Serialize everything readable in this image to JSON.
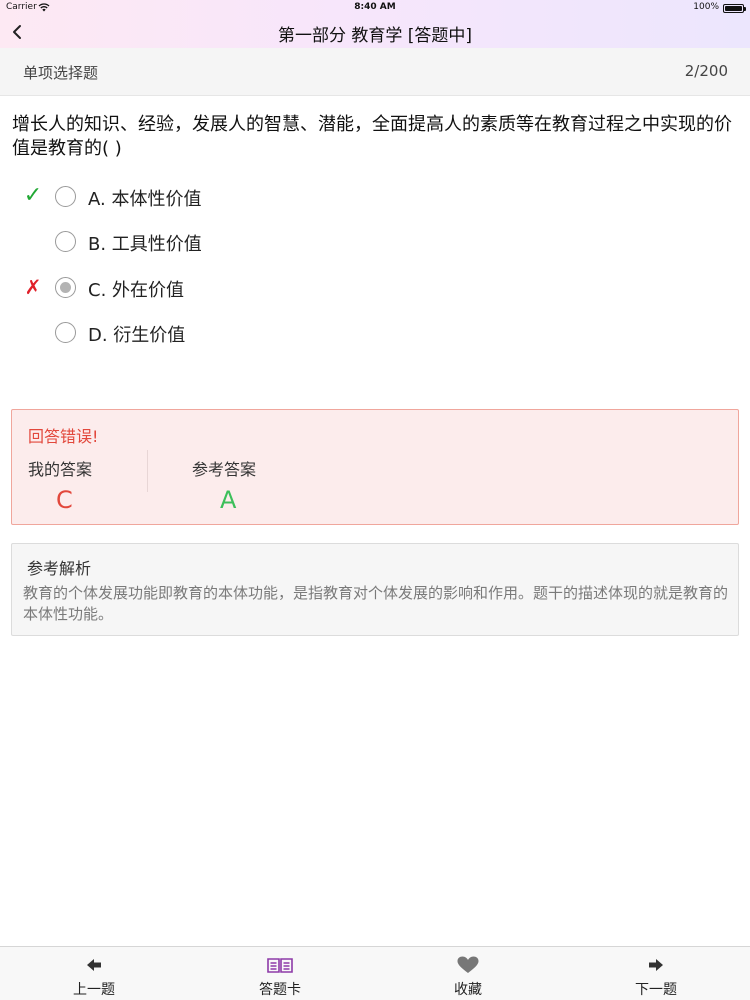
{
  "status_bar": {
    "carrier": "Carrier",
    "time": "8:40 AM",
    "battery": "100%"
  },
  "nav": {
    "title": "第一部分 教育学 [答题中]",
    "back_icon": "chevron-left-icon"
  },
  "sub_header": {
    "question_type": "单项选择题",
    "progress": "2/200"
  },
  "question": {
    "text": "增长人的知识、经验，发展人的智慧、潜能，全面提高人的素质等在教育过程之中实现的价值是教育的(   )",
    "options": [
      {
        "label": "A. 本体性价值",
        "mark": "✓",
        "mark_type": "correct",
        "selected": false
      },
      {
        "label": "B. 工具性价值",
        "mark": "",
        "mark_type": "none",
        "selected": false
      },
      {
        "label": "C. 外在价值",
        "mark": "✗",
        "mark_type": "wrong",
        "selected": true
      },
      {
        "label": "D. 衍生价值",
        "mark": "",
        "mark_type": "none",
        "selected": false
      }
    ]
  },
  "result": {
    "heading": "回答错误!",
    "my_answer_label": "我的答案",
    "my_answer": "C",
    "ref_answer_label": "参考答案",
    "ref_answer": "A",
    "colors": {
      "wrong": "#e2483c",
      "correct": "#3cbf5a"
    }
  },
  "explanation": {
    "heading": "参考解析",
    "body": "教育的个体发展功能即教育的本体功能，是指教育对个体发展的影响和作用。题干的描述体现的就是教育的本体性功能。"
  },
  "tab_bar": {
    "prev": {
      "label": "上一题",
      "icon": "arrow-left-icon"
    },
    "card": {
      "label": "答题卡",
      "icon": "open-book-icon",
      "color": "#8e3aa8"
    },
    "favorite": {
      "label": "收藏",
      "icon": "heart-icon"
    },
    "next": {
      "label": "下一题",
      "icon": "arrow-right-icon"
    }
  }
}
